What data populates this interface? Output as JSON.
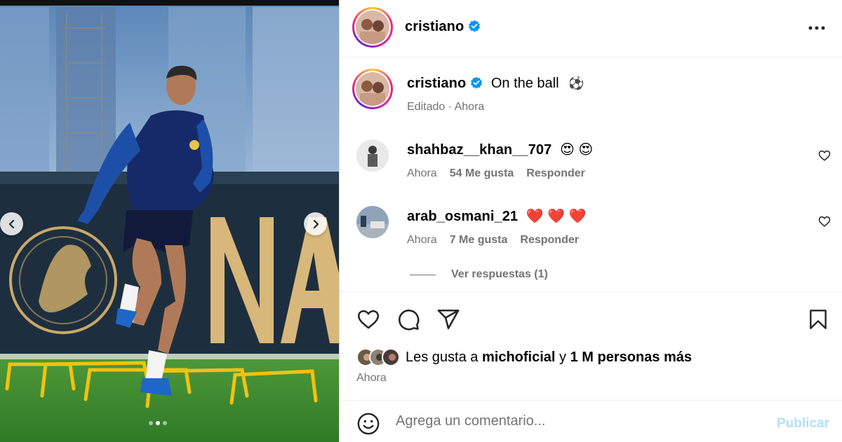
{
  "post": {
    "author": "cristiano",
    "verified": true,
    "caption_text": "On the ball",
    "caption_emoji": "⚽",
    "caption_meta": "Editado · Ahora",
    "carousel": {
      "total": 3,
      "active_index": 1
    }
  },
  "comments": [
    {
      "username": "shahbaz__khan__707",
      "emojis": "😍 😍",
      "time": "Ahora",
      "likes": "54 Me gusta",
      "reply": "Responder"
    },
    {
      "username": "arab_osmani_21",
      "emojis": "❤️ ❤️ ❤️",
      "time": "Ahora",
      "likes": "7 Me gusta",
      "reply": "Responder",
      "view_replies": "Ver respuestas (1)"
    }
  ],
  "likes_summary": {
    "prefix": "Les gusta a",
    "user": "michoficial",
    "joiner": "y",
    "rest": "1 M personas más"
  },
  "post_time": "Ahora",
  "composer": {
    "placeholder": "Agrega un comentario...",
    "submit": "Publicar"
  },
  "colors": {
    "verified": "#0095f6",
    "heart_red": "#ff3040",
    "publish_disabled": "#b2dffc",
    "meta_gray": "#737373"
  }
}
